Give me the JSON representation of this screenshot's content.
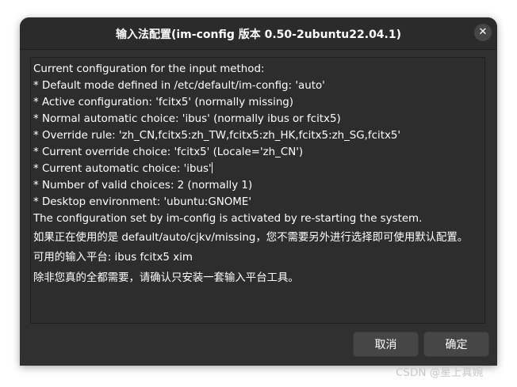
{
  "window": {
    "title": "输入法配置(im-config 版本 0.50-2ubuntu22.04.1)",
    "close_glyph": "✕"
  },
  "message": {
    "lines": [
      "Current configuration for the input method:",
      " * Default mode defined in /etc/default/im-config: 'auto'",
      " * Active configuration: 'fcitx5' (normally missing)",
      " * Normal automatic choice: 'ibus' (normally ibus or fcitx5)",
      " * Override rule: 'zh_CN,fcitx5:zh_TW,fcitx5:zh_HK,fcitx5:zh_SG,fcitx5'",
      " * Current override choice: 'fcitx5' (Locale='zh_CN')",
      " * Current automatic choice: 'ibus'",
      " * Number of valid choices: 2 (normally 1)",
      " * Desktop environment: 'ubuntu:GNOME'",
      "The configuration set by im-config is activated by re-starting the system.",
      "如果正在使用的是 default/auto/cjkv/missing，您不需要另外进行选择即可使用默认配置。",
      " 可用的输入平台: ibus fcitx5 xim",
      "除非您真的全都需要，请确认只安装一套输入平台工具。"
    ]
  },
  "buttons": {
    "cancel_label": "取消",
    "ok_label": "确定"
  },
  "watermark": {
    "text": "CSDN @星上真婉"
  }
}
